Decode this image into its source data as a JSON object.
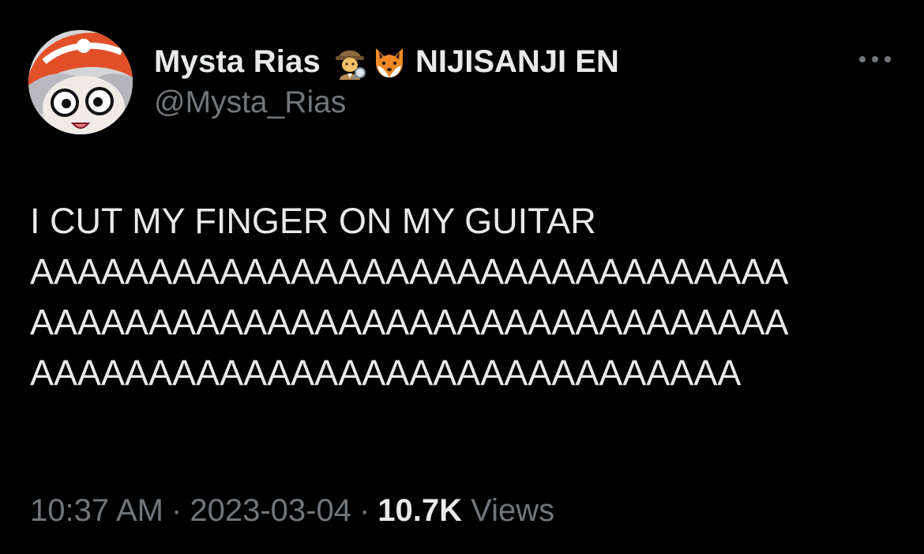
{
  "author": {
    "display_name": "Mysta Rias",
    "affiliation": "NIJISANJI EN",
    "handle": "@Mysta_Rias",
    "avatar_icon": "anime-avatar",
    "badge_icons": [
      "detective-icon",
      "fox-icon"
    ]
  },
  "menu": {
    "icon": "more-icon"
  },
  "tweet": {
    "lines": [
      "I CUT MY FINGER ON MY GUITAR",
      "AAAAAAAAAAAAAAAAAAAAAAAAAAAAAAAA",
      "AAAAAAAAAAAAAAAAAAAAAAAAAAAAAAAA",
      "AAAAAAAAAAAAAAAAAAAAAAAAAAAAAA"
    ]
  },
  "meta": {
    "time": "10:37 AM",
    "separator": "·",
    "date": "2023-03-04",
    "views_count": "10.7K",
    "views_label": "Views"
  },
  "colors": {
    "background": "#000000",
    "primary_text": "#e7e9ea",
    "secondary_text": "#71767b"
  }
}
